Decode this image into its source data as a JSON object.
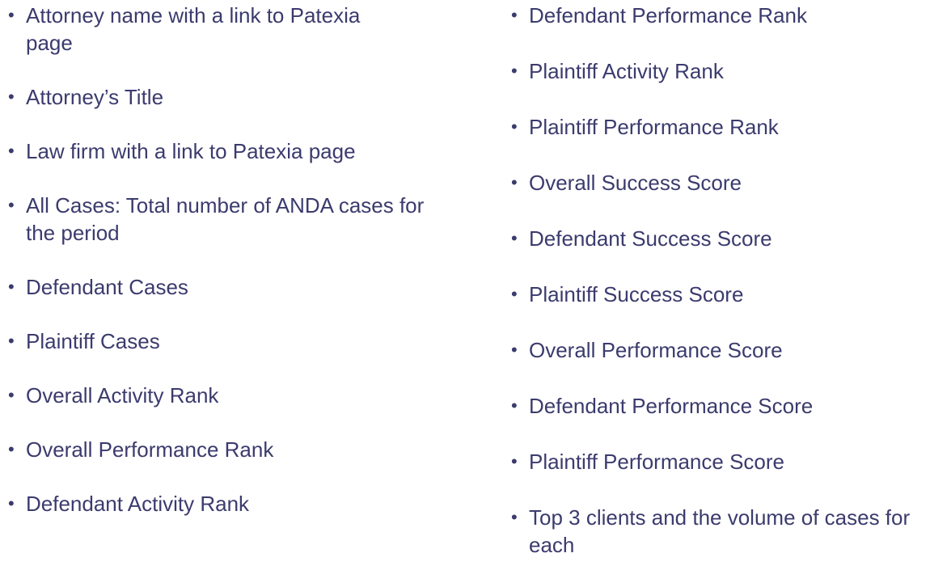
{
  "left_column": {
    "items": [
      "Attorney name with a link to Patexia page",
      "Attorney’s Title",
      "Law firm with a link to Patexia page",
      "All Cases: Total number of ANDA cases for the period",
      "Defendant Cases",
      "Plaintiff Cases",
      "Overall Activity Rank",
      "Overall Performance Rank",
      "Defendant Activity Rank"
    ]
  },
  "right_column": {
    "items": [
      "Defendant Performance Rank",
      "Plaintiff Activity Rank",
      "Plaintiff Performance Rank",
      "Overall Success Score",
      "Defendant Success Score",
      "Plaintiff Success Score",
      "Overall Performance Score",
      "Defendant Performance Score",
      "Plaintiff Performance Score",
      "Top 3 clients and the volume of cases for each"
    ]
  },
  "bullet_symbol": "•",
  "text_color": "#3b3b6e"
}
